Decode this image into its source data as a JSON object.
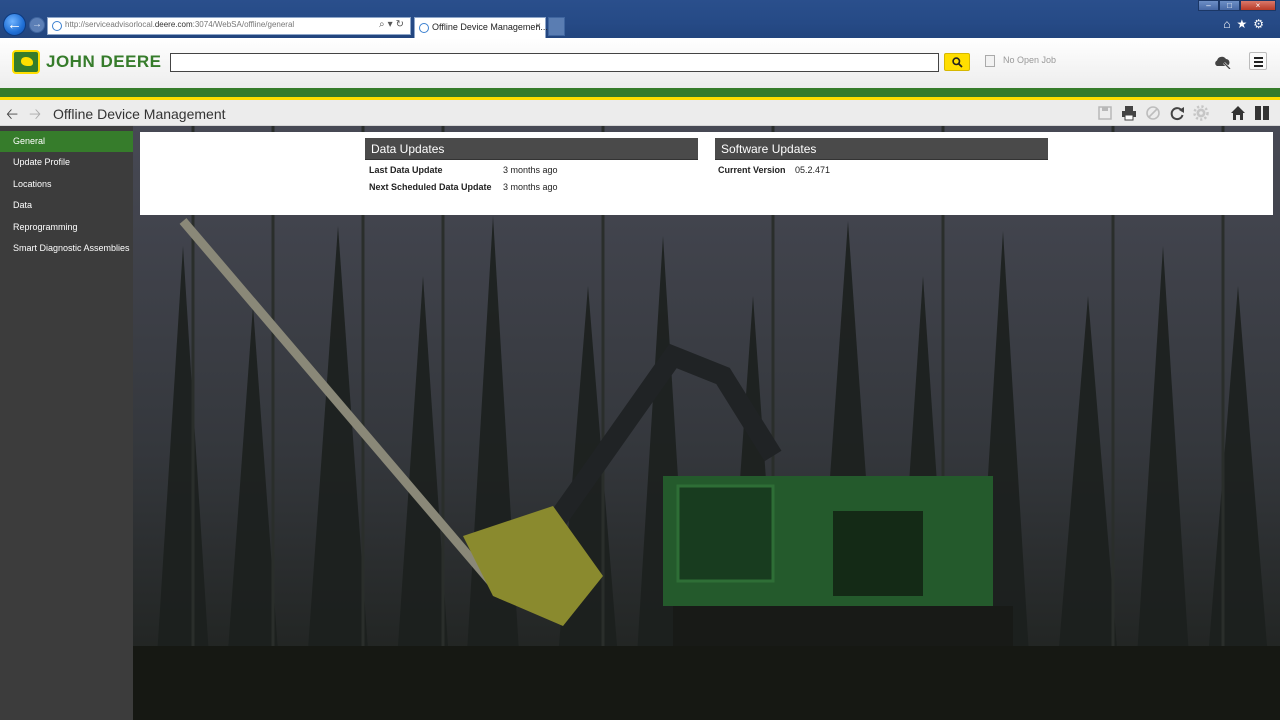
{
  "browser": {
    "url_prefix": "http://serviceadvisorlocal.",
    "url_domain": "deere.com",
    "url_suffix": ":3074/WebSA/offline/general",
    "tab_title": "Offline Device Managemen...",
    "tab_close": "×"
  },
  "header": {
    "brand": "JOHN DEERE",
    "search_value": "",
    "job_status": "No Open Job"
  },
  "toolbar": {
    "page_title": "Offline Device Management"
  },
  "sidebar": {
    "items": [
      {
        "label": "General",
        "active": true
      },
      {
        "label": "Update Profile",
        "active": false
      },
      {
        "label": "Locations",
        "active": false
      },
      {
        "label": "Data",
        "active": false
      },
      {
        "label": "Reprogramming",
        "active": false
      },
      {
        "label": "Smart Diagnostic Assemblies",
        "active": false
      }
    ]
  },
  "data_updates": {
    "title": "Data Updates",
    "rows": [
      {
        "label": "Last Data Update",
        "value": "3 months ago"
      },
      {
        "label": "Next Scheduled Data Update",
        "value": "3 months ago"
      }
    ]
  },
  "software_updates": {
    "title": "Software Updates",
    "rows": [
      {
        "label": "Current Version",
        "value": "05.2.471"
      }
    ]
  },
  "colors": {
    "brand_green": "#367c2b",
    "brand_yellow": "#ffde00",
    "sidebar_bg": "#3c3c3c",
    "card_header": "#4a4a4a"
  }
}
